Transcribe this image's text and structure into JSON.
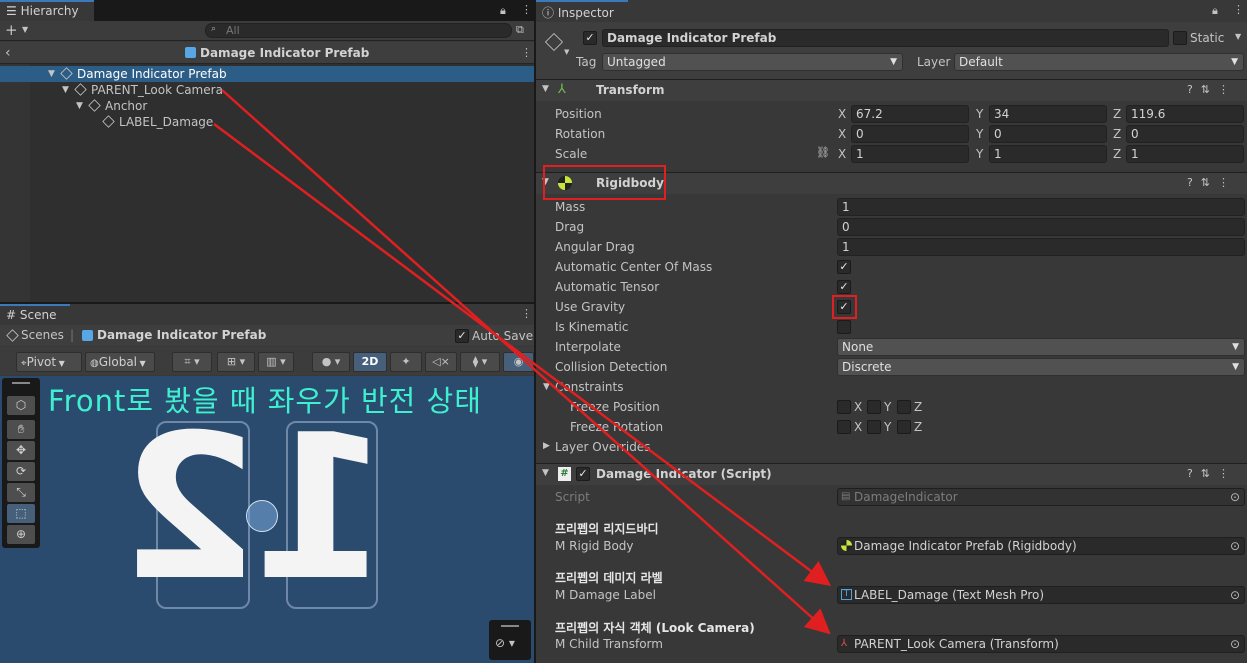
{
  "hierarchy": {
    "tab": "Hierarchy",
    "search_placeholder": "All",
    "breadcrumb": "Damage Indicator Prefab",
    "items": [
      {
        "label": "Damage Indicator Prefab",
        "selected": true
      },
      {
        "label": "PARENT_Look Camera"
      },
      {
        "label": "Anchor"
      },
      {
        "label": "LABEL_Damage"
      }
    ]
  },
  "scene": {
    "tab": "Scene",
    "breadcrumb_root": "Scenes",
    "breadcrumb_prefab": "Damage Indicator Prefab",
    "auto_save": "Auto Save",
    "toolbar": {
      "pivot": "Pivot",
      "global": "Global",
      "mode_2d": "2D"
    },
    "annotation": "Front로 봤을 때 좌우가 반전 상태",
    "mirrored_number": "12"
  },
  "inspector": {
    "tab": "Inspector",
    "object_name": "Damage Indicator Prefab",
    "static_label": "Static",
    "tag_label": "Tag",
    "tag_value": "Untagged",
    "layer_label": "Layer",
    "layer_value": "Default",
    "transform": {
      "title": "Transform",
      "position_label": "Position",
      "rotation_label": "Rotation",
      "scale_label": "Scale",
      "position": {
        "x": "67.2",
        "y": "34",
        "z": "119.6"
      },
      "rotation": {
        "x": "0",
        "y": "0",
        "z": "0"
      },
      "scale": {
        "x": "1",
        "y": "1",
        "z": "1"
      }
    },
    "rigidbody": {
      "title": "Rigidbody",
      "mass_label": "Mass",
      "mass": "1",
      "drag_label": "Drag",
      "drag": "0",
      "angular_drag_label": "Angular Drag",
      "angular_drag": "1",
      "auto_com_label": "Automatic Center Of Mass",
      "auto_tensor_label": "Automatic Tensor",
      "use_gravity_label": "Use Gravity",
      "is_kinematic_label": "Is Kinematic",
      "interpolate_label": "Interpolate",
      "interpolate": "None",
      "collision_label": "Collision Detection",
      "collision": "Discrete",
      "constraints_label": "Constraints",
      "freeze_position_label": "Freeze Position",
      "freeze_rotation_label": "Freeze Rotation",
      "layer_overrides_label": "Layer Overrides",
      "x": "X",
      "y": "Y",
      "z": "Z"
    },
    "script": {
      "title": "Damage Indicator (Script)",
      "script_label": "Script",
      "script_value": "DamageIndicator",
      "header1": "프리펩의 리지드바디",
      "rigid_label": "M Rigid Body",
      "rigid_value": "Damage Indicator Prefab (Rigidbody)",
      "header2": "프리펩의 데미지 라벨",
      "damage_label": "M Damage Label",
      "damage_value": "LABEL_Damage (Text Mesh Pro)",
      "header3": "프리펩의 자식 객체 (Look Camera)",
      "child_label": "M Child Transform",
      "child_value": "PARENT_Look Camera (Transform)"
    }
  },
  "colors": {
    "accent": "#3a79bb",
    "highlight_box": "#e02020",
    "scene_bg": "#2a4a6e",
    "annotation": "#3ff0d0"
  }
}
